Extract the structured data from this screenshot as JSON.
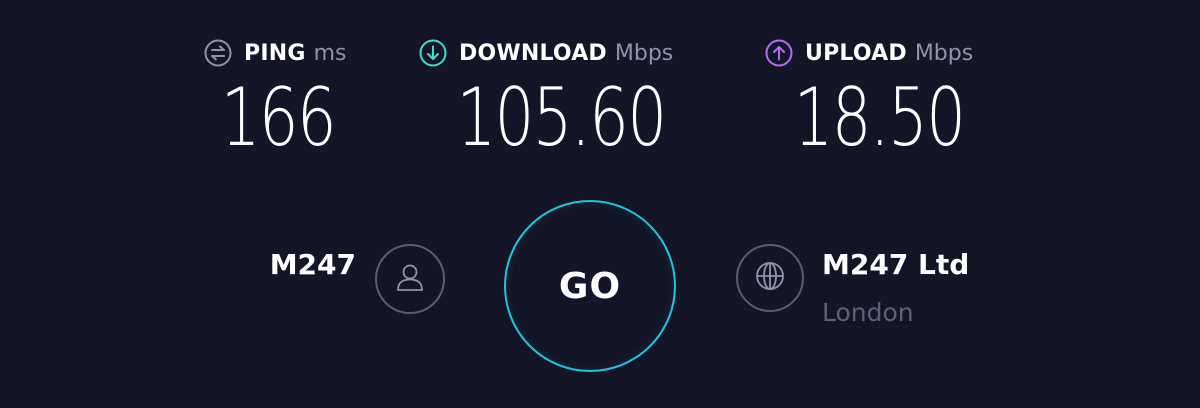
{
  "metrics": {
    "ping": {
      "label": "PING",
      "unit": "ms",
      "value": "166",
      "icon": "ping-icon",
      "color": "#9193a8"
    },
    "download": {
      "label": "DOWNLOAD",
      "unit": "Mbps",
      "value": "105.60",
      "icon": "download-arrow-icon",
      "color": "#3ee0c4"
    },
    "upload": {
      "label": "UPLOAD",
      "unit": "Mbps",
      "value": "18.50",
      "icon": "upload-arrow-icon",
      "color": "#b56cf2"
    }
  },
  "go_button": {
    "label": "GO",
    "ring_color": "#1fc5e0"
  },
  "provider": {
    "name": "M247",
    "icon": "user-icon"
  },
  "server": {
    "name": "M247 Ltd",
    "location": "London",
    "icon": "globe-icon"
  },
  "colors": {
    "background": "#141526",
    "muted_text": "#9193a8",
    "dim_text": "#5e6075",
    "ring_border": "#5b5d70"
  }
}
